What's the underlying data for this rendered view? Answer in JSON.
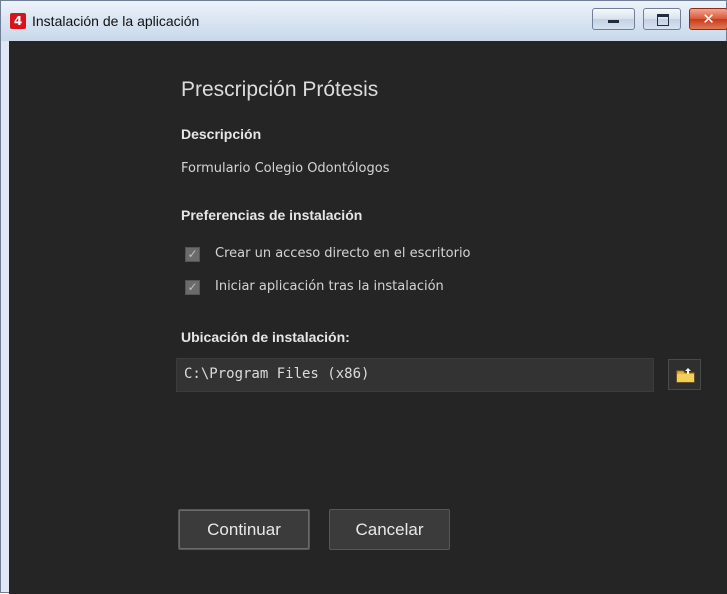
{
  "window": {
    "title": "Instalación de la aplicación",
    "app_icon_glyph": "4"
  },
  "controls": {
    "minimize": "minimize-icon",
    "maximize": "maximize-icon",
    "close_glyph": "✕"
  },
  "app": {
    "name": "Prescripción Prótesis",
    "description_label": "Descripción",
    "description": "Formulario Colegio Odontólogos"
  },
  "preferences": {
    "label": "Preferencias de instalación",
    "options": [
      {
        "label": "Crear un acceso directo en el escritorio",
        "checked": true
      },
      {
        "label": "Iniciar aplicación tras la instalación",
        "checked": true
      }
    ]
  },
  "location": {
    "label": "Ubicación de instalación:",
    "value": "C:\\Program Files (x86)",
    "browse_icon": "folder-icon"
  },
  "buttons": {
    "continue": "Continuar",
    "cancel": "Cancelar"
  },
  "colors": {
    "panel": "#252525",
    "accent_icon": "#d7141a"
  }
}
